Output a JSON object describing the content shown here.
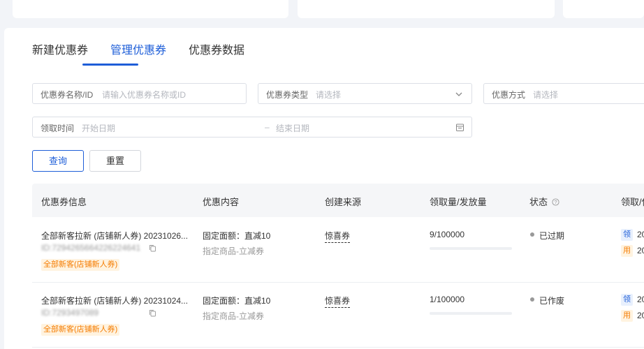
{
  "tabs": [
    "新建优惠券",
    "管理优惠券",
    "优惠券数据"
  ],
  "filters": {
    "name": {
      "label": "优惠券名称/ID",
      "placeholder": "请输入优惠券名称或ID"
    },
    "type": {
      "label": "优惠券类型",
      "placeholder": "请选择"
    },
    "method": {
      "label": "优惠方式",
      "placeholder": "请选择"
    },
    "date": {
      "label": "领取时间",
      "start_placeholder": "开始日期",
      "separator": "–",
      "end_placeholder": "结束日期"
    }
  },
  "buttons": {
    "query": "查询",
    "reset": "重置"
  },
  "table": {
    "headers": [
      "优惠券信息",
      "优惠内容",
      "创建来源",
      "领取量/发放量",
      "状态",
      "领取/使"
    ],
    "rows": [
      {
        "title": "全部新客拉新 (店铺新人券) 20231026...",
        "id": "ID:7294265664226224641",
        "tag": "全部新客(店铺新人券)",
        "content": "固定面额：直减10",
        "content_sub": "指定商品-立减券",
        "source": "惊喜券",
        "claimed": "9/100000",
        "progress": 9e-05,
        "status": "已过期",
        "label_claim": "领",
        "label_use": "用",
        "date_claim": "20",
        "date_use": "20"
      },
      {
        "title": "全部新客拉新 (店铺新人券) 20231024...",
        "id": "ID:7293497089",
        "tag": "全部新客(店铺新人券)",
        "content": "固定面额：直减10",
        "content_sub": "指定商品-立减券",
        "source": "惊喜券",
        "claimed": "1/100000",
        "progress": 1e-05,
        "status": "已作废",
        "label_claim": "领",
        "label_use": "用",
        "date_claim": "20",
        "date_use": "20"
      }
    ]
  },
  "colors": {
    "accent": "#1e5ed8",
    "tag_orange": "#f57c00",
    "status_gray": "#999999"
  },
  "icons": [
    "chevron-down-icon",
    "calendar-icon",
    "info-icon",
    "copy-icon"
  ]
}
